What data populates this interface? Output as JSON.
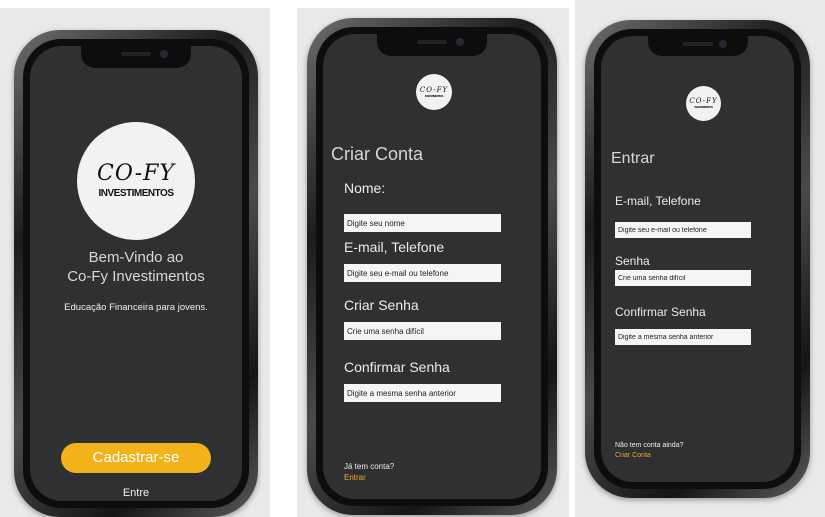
{
  "colors": {
    "screen_bg": "#2f3032",
    "accent": "#f1b21a",
    "field_bg": "#f5f5f5",
    "text": "#ececec"
  },
  "logo": {
    "line1": "CO-FY",
    "line2": "INVESTIMENTOS"
  },
  "welcome": {
    "title_line1": "Bem-Vindo ao",
    "title_line2": "Co-Fy Investimentos",
    "subtitle": "Educação Financeira para jovens.",
    "signup_button": "Cadastrar-se",
    "login_link": "Entre"
  },
  "signup": {
    "title": "Criar Conta",
    "name_label": "Nome:",
    "name_placeholder": "Digite seu nome",
    "email_label": "E-mail, Telefone",
    "email_placeholder": "Digite seu e-mail ou telefone",
    "password_label": "Criar Senha",
    "password_placeholder": "Crie uma senha difícil",
    "confirm_label": "Confirmar Senha",
    "confirm_placeholder": "Digite a mesma senha anterior",
    "footer_question": "Já tem conta?",
    "footer_link": "Entrar"
  },
  "login": {
    "title": "Entrar",
    "email_label": "E-mail, Telefone",
    "email_placeholder": "Digite seu e-mail ou telefone",
    "password_label": "Senha",
    "password_placeholder": "Crie uma senha difícil",
    "confirm_label": "Confirmar Senha",
    "confirm_placeholder": "Digite a mesma senha anterior",
    "footer_question": "Não tem conta ainda?",
    "footer_link": "Criar Conta"
  }
}
